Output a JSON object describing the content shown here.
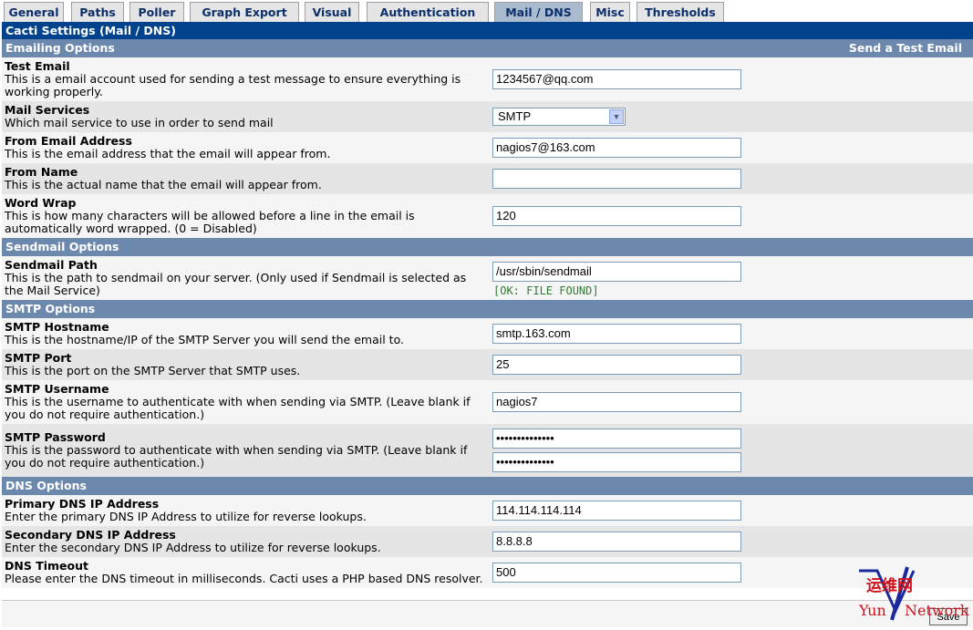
{
  "tabs": [
    {
      "label": "General",
      "active": false
    },
    {
      "label": "Paths",
      "active": false
    },
    {
      "label": "Poller",
      "active": false
    },
    {
      "label": "Graph Export",
      "active": false
    },
    {
      "label": "Visual",
      "active": false
    },
    {
      "label": "Authentication",
      "active": false
    },
    {
      "label": "Mail / DNS",
      "active": true
    },
    {
      "label": "Misc",
      "active": false
    },
    {
      "label": "Thresholds",
      "active": false
    }
  ],
  "page": {
    "title": "Cacti Settings (Mail / DNS)"
  },
  "sections": {
    "emailing": {
      "title": "Emailing Options",
      "action": "Send a Test Email"
    },
    "sendmail": {
      "title": "Sendmail Options"
    },
    "smtp": {
      "title": "SMTP Options"
    },
    "dns": {
      "title": "DNS Options"
    }
  },
  "fields": {
    "test_email": {
      "label": "Test Email",
      "desc": "This is a email account used for sending a test message to ensure everything is working properly.",
      "value": "1234567@qq.com"
    },
    "mail_services": {
      "label": "Mail Services",
      "desc": "Which mail service to use in order to send mail",
      "value": "SMTP"
    },
    "from_email": {
      "label": "From Email Address",
      "desc": "This is the email address that the email will appear from.",
      "value": "nagios7@163.com"
    },
    "from_name": {
      "label": "From Name",
      "desc": "This is the actual name that the email will appear from.",
      "value": ""
    },
    "word_wrap": {
      "label": "Word Wrap",
      "desc": "This is how many characters will be allowed before a line in the email is automatically word wrapped. (0 = Disabled)",
      "value": "120"
    },
    "sendmail_path": {
      "label": "Sendmail Path",
      "desc": "This is the path to sendmail on your server. (Only used if Sendmail is selected as the Mail Service)",
      "value": "/usr/sbin/sendmail",
      "status": "[OK: FILE FOUND]"
    },
    "smtp_host": {
      "label": "SMTP Hostname",
      "desc": "This is the hostname/IP of the SMTP Server you will send the email to.",
      "value": "smtp.163.com"
    },
    "smtp_port": {
      "label": "SMTP Port",
      "desc": "This is the port on the SMTP Server that SMTP uses.",
      "value": "25"
    },
    "smtp_user": {
      "label": "SMTP Username",
      "desc": "This is the username to authenticate with when sending via SMTP. (Leave blank if you do not require authentication.)",
      "value": "nagios7"
    },
    "smtp_pass": {
      "label": "SMTP Password",
      "desc": "This is the password to authenticate with when sending via SMTP. (Leave blank if you do not require authentication.)",
      "value": "••••••••••••••",
      "confirm": "••••••••••••••"
    },
    "dns_primary": {
      "label": "Primary DNS IP Address",
      "desc": "Enter the primary DNS IP Address to utilize for reverse lookups.",
      "value": "114.114.114.114"
    },
    "dns_secondary": {
      "label": "Secondary DNS IP Address",
      "desc": "Enter the secondary DNS IP Address to utilize for reverse lookups.",
      "value": "8.8.8.8"
    },
    "dns_timeout": {
      "label": "DNS Timeout",
      "desc": "Please enter the DNS timeout in milliseconds. Cacti uses a PHP based DNS resolver.",
      "value": "500"
    }
  },
  "footer": {
    "save_label": "Save"
  },
  "watermark": {
    "cn": "运维网",
    "en_left": "Yun",
    "en_right": "Network"
  },
  "colors": {
    "title_bar": "#00438c",
    "section_bar": "#6d88ad",
    "row_alt": "#e5e5e5",
    "ok": "#2e7d32",
    "watermark_red": "#d0101a",
    "watermark_blue": "#1a2a9c"
  }
}
